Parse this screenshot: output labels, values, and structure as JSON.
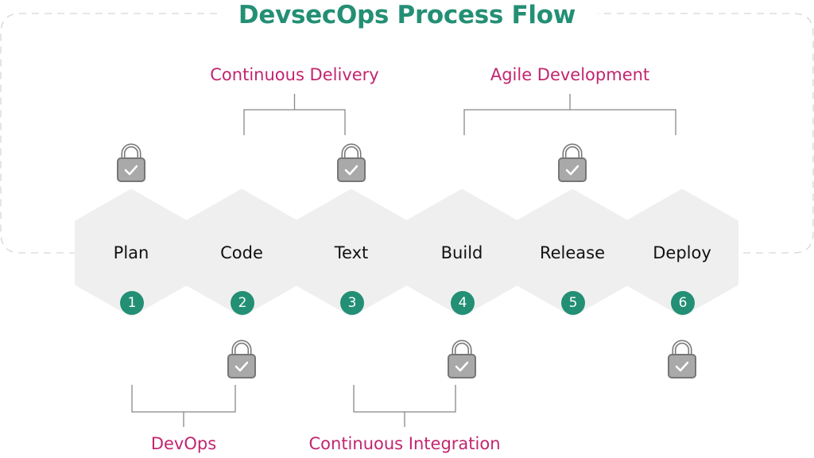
{
  "title": "DevsecOps Process Flow",
  "colors": {
    "title": "#238f74",
    "accent_label": "#c2256f",
    "hexagon_fill": "#efefef",
    "badge_fill": "#238f74",
    "lock_fill": "#a9a9a9",
    "lock_stroke": "#767676",
    "connector": "#888888",
    "dashed_frame": "#d6d6d6"
  },
  "stages": [
    {
      "label": "Plan",
      "number": "1",
      "lock": "top"
    },
    {
      "label": "Code",
      "number": "2",
      "lock": "bottom"
    },
    {
      "label": "Text",
      "number": "3",
      "lock": "top"
    },
    {
      "label": "Build",
      "number": "4",
      "lock": "bottom"
    },
    {
      "label": "Release",
      "number": "5",
      "lock": "top"
    },
    {
      "label": "Deploy",
      "number": "6",
      "lock": "bottom"
    }
  ],
  "groups": [
    {
      "label": "Continuous Delivery",
      "position": "top",
      "from_stage": 2,
      "to_stage": 3
    },
    {
      "label": "Agile Development",
      "position": "top",
      "from_stage": 4,
      "to_stage": 6
    },
    {
      "label": "DevOps",
      "position": "bottom",
      "from_stage": 1,
      "to_stage": 2
    },
    {
      "label": "Continuous Integration",
      "position": "bottom",
      "from_stage": 3,
      "to_stage": 4
    }
  ],
  "icons": {
    "lock": "lock-check-icon"
  }
}
